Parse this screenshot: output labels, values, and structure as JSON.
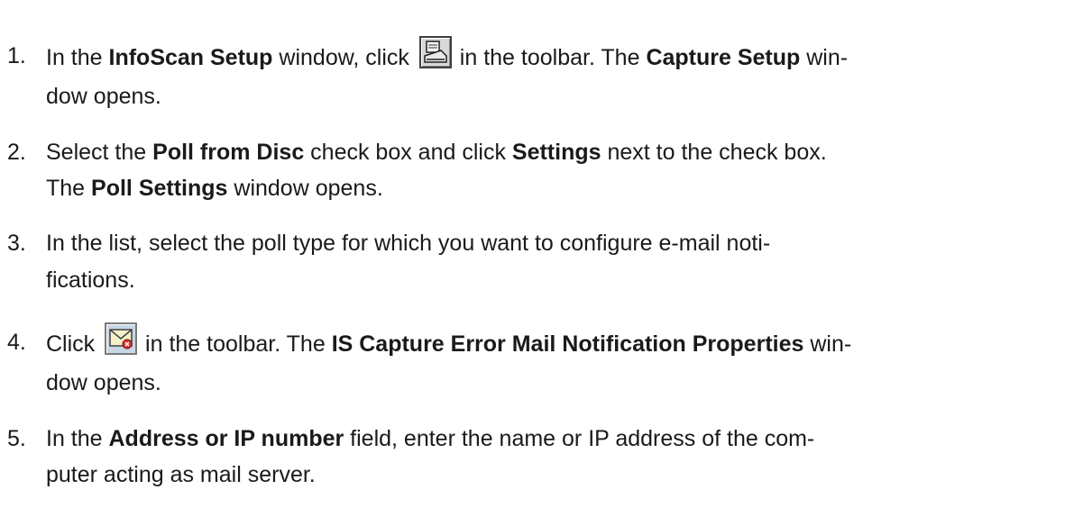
{
  "steps": [
    {
      "number": "1.",
      "line1": {
        "t1": "In the ",
        "b1": "InfoScan Setup",
        "t2": " window, click ",
        "t3": " in the toolbar. The ",
        "b2": "Capture Setup",
        "t4": " win-"
      },
      "line2": "dow opens.",
      "icon": "scanner-toolbar-icon"
    },
    {
      "number": "2.",
      "line1": {
        "t1": "Select the ",
        "b1": "Poll from Disc",
        "t2": " check box and click ",
        "b2": "Settings",
        "t3": " next to the check box."
      },
      "line2": {
        "t1": "The ",
        "b1": "Poll Settings",
        "t2": " window opens."
      }
    },
    {
      "number": "3.",
      "line1": "In the list, select the poll type for which you want to configure e-mail noti-",
      "line2": "fications."
    },
    {
      "number": "4.",
      "line1": {
        "t1": "Click ",
        "t2": " in the toolbar. The ",
        "b1": "IS Capture Error Mail Notification Properties",
        "t3": " win-"
      },
      "line2": "dow opens.",
      "icon": "mail-notification-toolbar-icon"
    },
    {
      "number": "5.",
      "line1": {
        "t1": "In the ",
        "b1": "Address or IP number",
        "t2": " field, enter the name or IP address of the com-"
      },
      "line2": "puter acting as mail server."
    }
  ],
  "colors": {
    "text": "#1a1a1a",
    "background": "#ffffff"
  }
}
